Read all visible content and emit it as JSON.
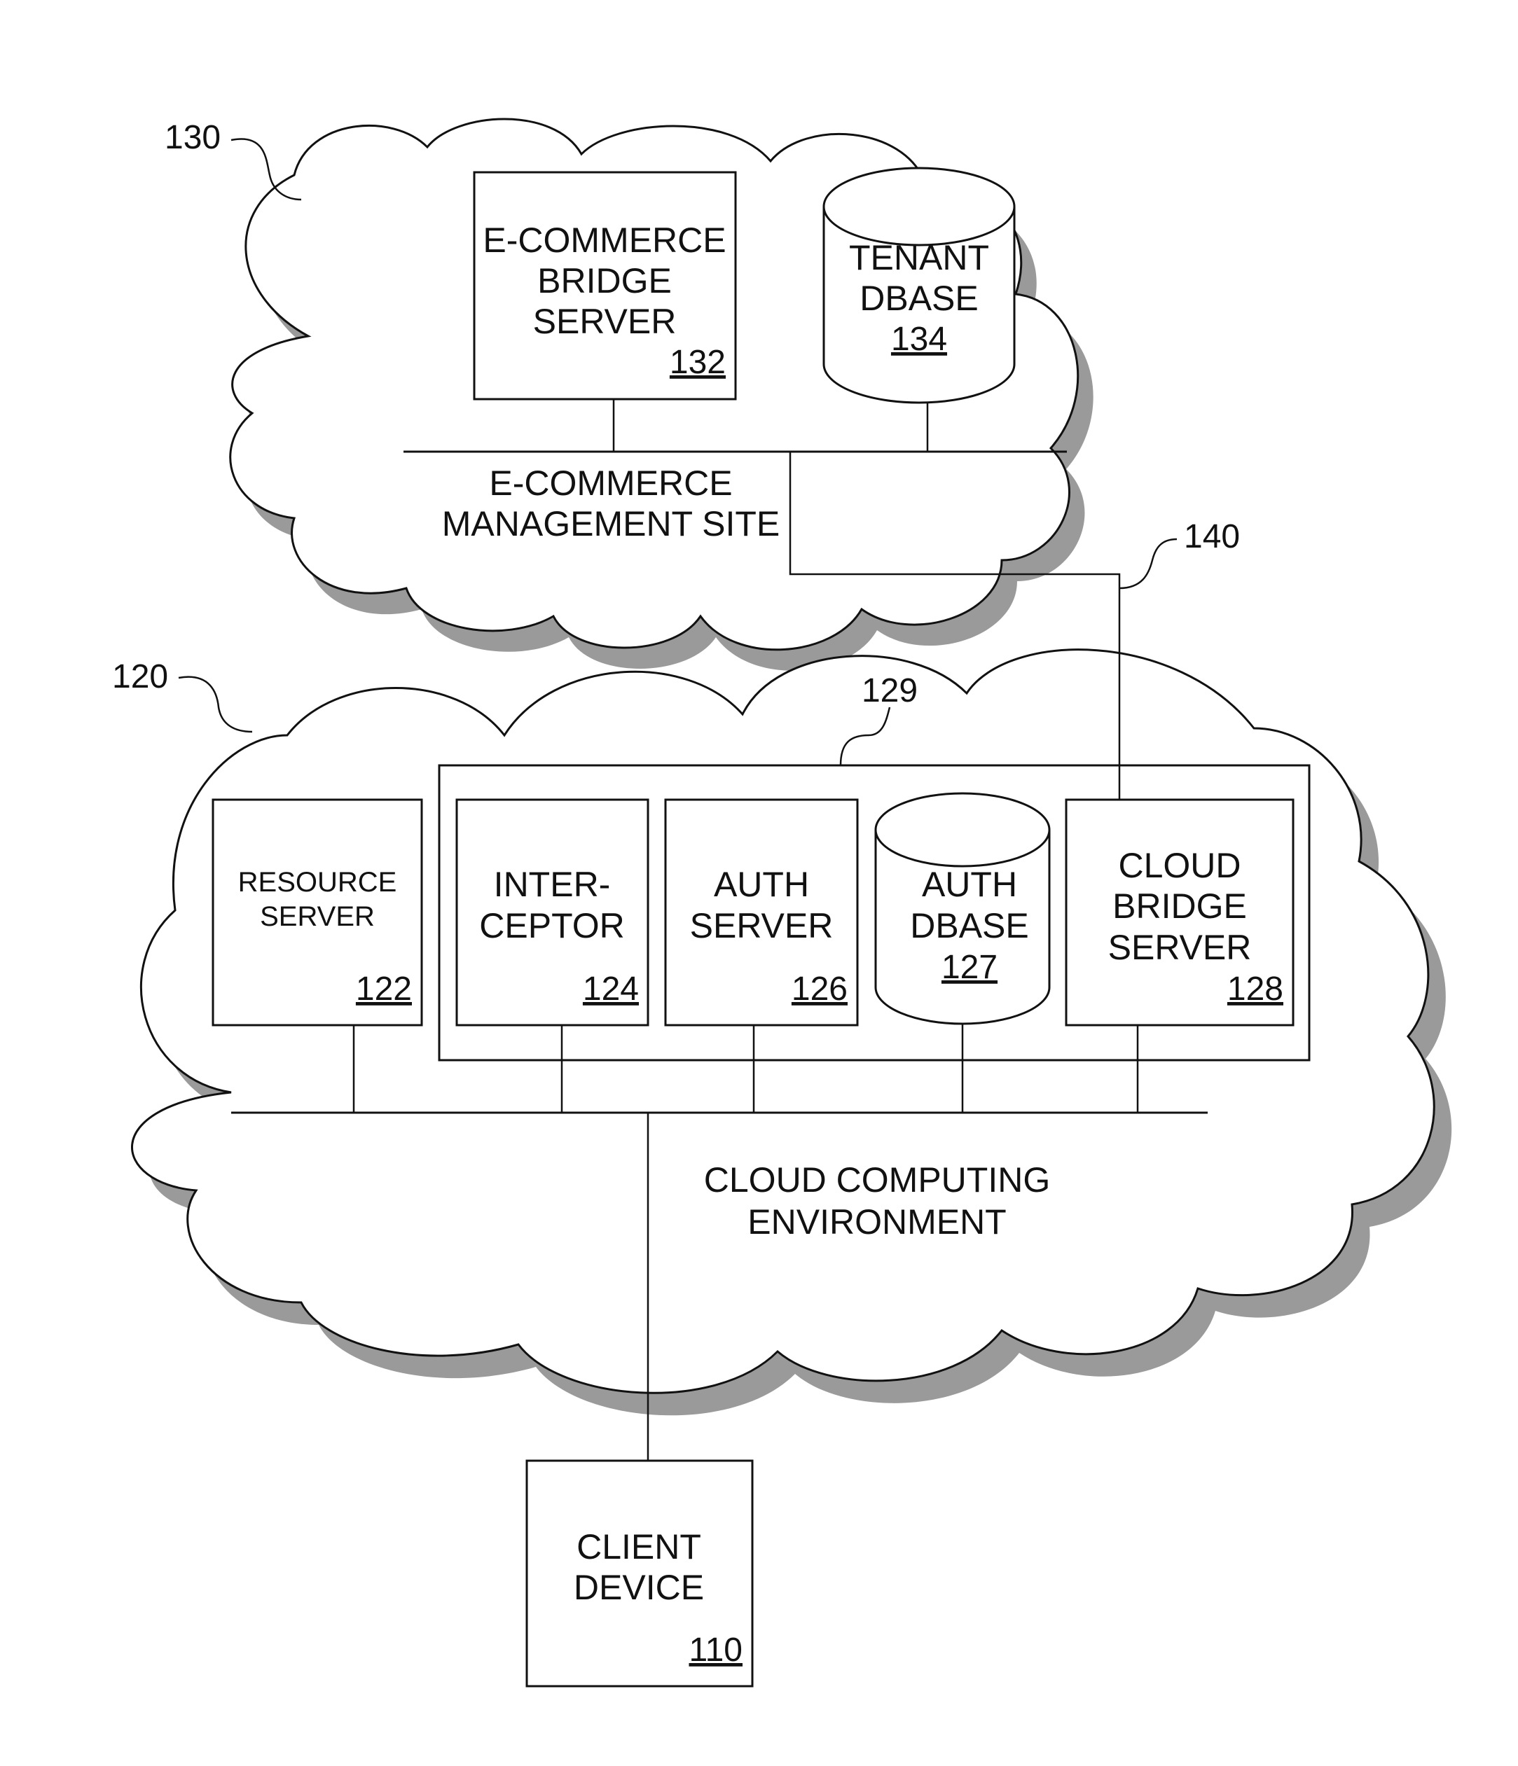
{
  "figure": {
    "clouds": [
      {
        "id": "130",
        "ref_label": "130",
        "title_lines": [
          "E-COMMERCE",
          "MANAGEMENT SITE"
        ]
      },
      {
        "id": "120",
        "ref_label": "120",
        "title_lines": [
          "CLOUD COMPUTING",
          "ENVIRONMENT"
        ]
      }
    ],
    "components": {
      "ecommerce_bridge_server": {
        "lines": [
          "E-COMMERCE",
          "BRIDGE",
          "SERVER"
        ],
        "ref": "132"
      },
      "tenant_dbase": {
        "lines": [
          "TENANT",
          "DBASE"
        ],
        "ref": "134"
      },
      "resource_server": {
        "lines": [
          "RESOURCE",
          "SERVER"
        ],
        "ref": "122"
      },
      "interceptor": {
        "lines": [
          "INTER-",
          "CEPTOR"
        ],
        "ref": "124"
      },
      "auth_server": {
        "lines": [
          "AUTH",
          "SERVER"
        ],
        "ref": "126"
      },
      "auth_dbase": {
        "lines": [
          "AUTH",
          "DBASE"
        ],
        "ref": "127"
      },
      "cloud_bridge_server": {
        "lines": [
          "CLOUD",
          "BRIDGE",
          "SERVER"
        ],
        "ref": "128"
      },
      "client_device": {
        "lines": [
          "CLIENT",
          "DEVICE"
        ],
        "ref": "110"
      }
    },
    "group_ref": "129",
    "connection_ref": "140"
  }
}
